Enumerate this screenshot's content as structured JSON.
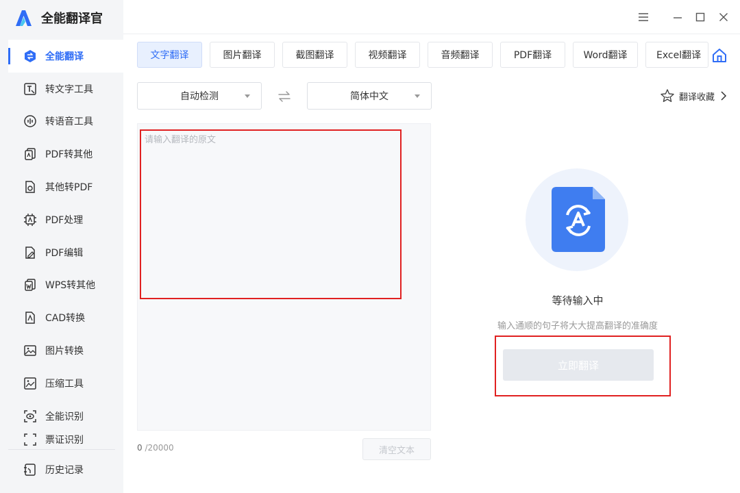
{
  "app": {
    "title": "全能翻译官"
  },
  "sidebar": {
    "items": [
      {
        "label": "全能翻译",
        "icon": "translate-swap-icon",
        "active": true
      },
      {
        "label": "转文字工具",
        "icon": "text-tool-icon"
      },
      {
        "label": "转语音工具",
        "icon": "voice-icon"
      },
      {
        "label": "PDF转其他",
        "icon": "pdf-convert-icon"
      },
      {
        "label": "其他转PDF",
        "icon": "to-pdf-icon"
      },
      {
        "label": "PDF处理",
        "icon": "pdf-process-icon"
      },
      {
        "label": "PDF编辑",
        "icon": "pdf-edit-icon"
      },
      {
        "label": "WPS转其他",
        "icon": "wps-icon"
      },
      {
        "label": "CAD转换",
        "icon": "cad-icon"
      },
      {
        "label": "图片转换",
        "icon": "image-icon"
      },
      {
        "label": "压缩工具",
        "icon": "compress-icon"
      },
      {
        "label": "全能识别",
        "icon": "scan-eye-icon"
      },
      {
        "label": "票证识别",
        "icon": "ticket-icon",
        "partially_visible": true
      }
    ],
    "history": "历史记录"
  },
  "tabs": [
    {
      "label": "文字翻译",
      "active": true
    },
    {
      "label": "图片翻译"
    },
    {
      "label": "截图翻译"
    },
    {
      "label": "视频翻译"
    },
    {
      "label": "音频翻译"
    },
    {
      "label": "PDF翻译"
    },
    {
      "label": "Word翻译"
    },
    {
      "label": "Excel翻译"
    }
  ],
  "lang": {
    "source": "自动检测",
    "target": "简体中文"
  },
  "favorites": "翻译收藏",
  "input": {
    "placeholder": "请输入翻译的原文",
    "count": "0",
    "limit": " /20000"
  },
  "clear_button": "清空文本",
  "result": {
    "status": "等待输入中",
    "hint": "输入通顺的句子将大大提高翻译的准确度",
    "button": "立即翻译"
  },
  "colors": {
    "accent": "#2f6df6",
    "annotation": "#e02020",
    "sidebar_bg": "#f4f5f7"
  }
}
